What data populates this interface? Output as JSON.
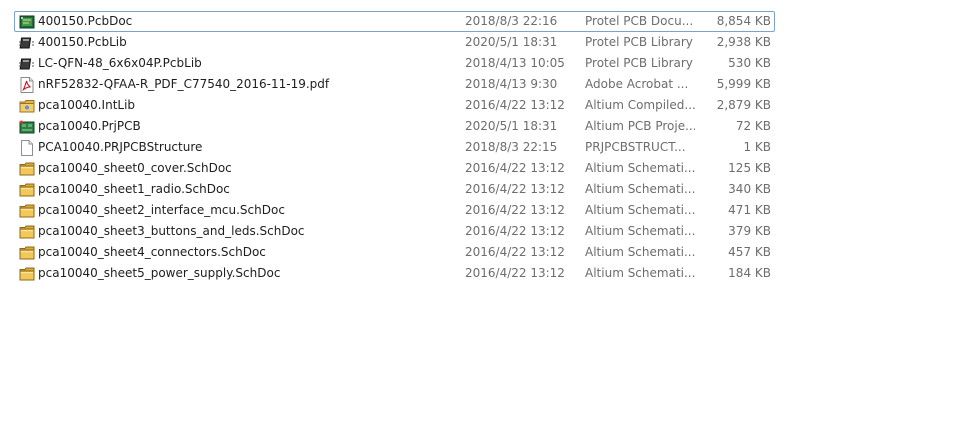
{
  "files": [
    {
      "name": "400150.PcbDoc",
      "modified": "2018/8/3 22:16",
      "type": "Protel PCB Docu...",
      "size": "8,854 KB",
      "icon": "pcb-doc-icon"
    },
    {
      "name": "400150.PcbLib",
      "modified": "2020/5/1 18:31",
      "type": "Protel PCB Library",
      "size": "2,938 KB",
      "icon": "pcb-lib-icon"
    },
    {
      "name": "LC-QFN-48_6x6x04P.PcbLib",
      "modified": "2018/4/13 10:05",
      "type": "Protel PCB Library",
      "size": "530 KB",
      "icon": "pcb-lib-icon"
    },
    {
      "name": "nRF52832-QFAA-R_PDF_C77540_2016-11-19.pdf",
      "modified": "2018/4/13 9:30",
      "type": "Adobe Acrobat ...",
      "size": "5,999 KB",
      "icon": "pdf-icon"
    },
    {
      "name": "pca10040.IntLib",
      "modified": "2016/4/22 13:12",
      "type": "Altium Compiled...",
      "size": "2,879 KB",
      "icon": "intlib-icon"
    },
    {
      "name": "pca10040.PrjPCB",
      "modified": "2020/5/1 18:31",
      "type": "Altium PCB Proje...",
      "size": "72 KB",
      "icon": "pcb-project-icon"
    },
    {
      "name": "PCA10040.PRJPCBStructure",
      "modified": "2018/8/3 22:15",
      "type": "PRJPCBSTRUCT...",
      "size": "1 KB",
      "icon": "blank-file-icon"
    },
    {
      "name": "pca10040_sheet0_cover.SchDoc",
      "modified": "2016/4/22 13:12",
      "type": "Altium Schemati...",
      "size": "125 KB",
      "icon": "schematic-icon"
    },
    {
      "name": "pca10040_sheet1_radio.SchDoc",
      "modified": "2016/4/22 13:12",
      "type": "Altium Schemati...",
      "size": "340 KB",
      "icon": "schematic-icon"
    },
    {
      "name": "pca10040_sheet2_interface_mcu.SchDoc",
      "modified": "2016/4/22 13:12",
      "type": "Altium Schemati...",
      "size": "471 KB",
      "icon": "schematic-icon"
    },
    {
      "name": "pca10040_sheet3_buttons_and_leds.SchDoc",
      "modified": "2016/4/22 13:12",
      "type": "Altium Schemati...",
      "size": "379 KB",
      "icon": "schematic-icon"
    },
    {
      "name": "pca10040_sheet4_connectors.SchDoc",
      "modified": "2016/4/22 13:12",
      "type": "Altium Schemati...",
      "size": "457 KB",
      "icon": "schematic-icon"
    },
    {
      "name": "pca10040_sheet5_power_supply.SchDoc",
      "modified": "2016/4/22 13:12",
      "type": "Altium Schemati...",
      "size": "184 KB",
      "icon": "schematic-icon"
    }
  ],
  "colors": {
    "focus_border": "#7da2ce",
    "name_text": "#1e1e1e",
    "detail_text": "#6d6d6d"
  }
}
